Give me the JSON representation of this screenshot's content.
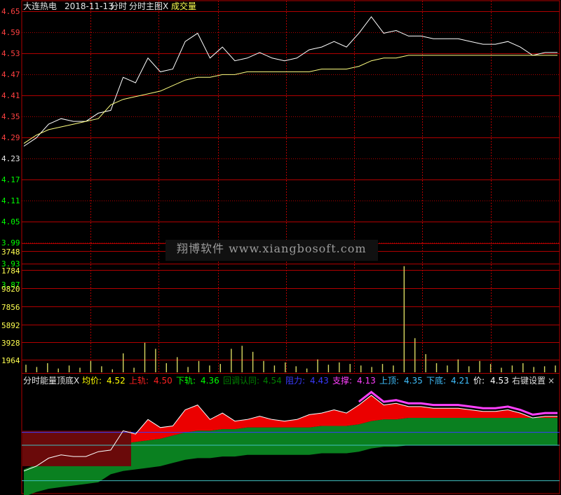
{
  "header": {
    "stock_name": "大连热电",
    "date": "2018-11-13",
    "mode": "分时",
    "main_chart_toggle": "分时主图X",
    "volume_label": "成交量"
  },
  "price_axis": [
    "4.65",
    "4.59",
    "4.53",
    "4.47",
    "4.41",
    "4.35",
    "4.29",
    "4.23",
    "4.17",
    "4.11",
    "4.05",
    "3.99",
    "3.93",
    "3.87"
  ],
  "volume_axis": [
    "3748",
    "1784",
    "9820",
    "7856",
    "5892",
    "3928",
    "1964"
  ],
  "watermark": "翔博软件 www.xiangbosoft.com",
  "indicator": {
    "name": "分时能量顶底X",
    "items": [
      {
        "label": "均价:",
        "value": "4.52",
        "color": "#ffff00"
      },
      {
        "label": "上轨:",
        "value": "4.50",
        "color": "#ff2020"
      },
      {
        "label": "下轨:",
        "value": "4.36",
        "color": "#00ff00"
      },
      {
        "label": "回调认同:",
        "value": "4.54",
        "color": "#008000"
      },
      {
        "label": "阻力:",
        "value": "4.43",
        "color": "#3a3aff"
      },
      {
        "label": "支撑:",
        "value": "4.13",
        "color": "#ff40ff"
      },
      {
        "label": "上顶:",
        "value": "4.35",
        "color": "#40c0ff"
      },
      {
        "label": "下底:",
        "value": "4.21",
        "color": "#40c0ff"
      },
      {
        "label": "价:",
        "value": "4.53",
        "color": "#ffffff"
      }
    ],
    "settings_label": "右键设置",
    "close_label": "×"
  },
  "colors": {
    "grid": "#b00000",
    "price_line": "#ffffff",
    "avg_line": "#ffff80",
    "volume_bar": "#d8d860",
    "up_axis": "#ff4040",
    "down_axis": "#00ff00",
    "volume_axis": "#ffff50"
  },
  "chart_data": [
    {
      "type": "line",
      "series": [
        {
          "values": [
            4.19,
            4.22,
            4.27,
            4.29,
            4.28,
            4.28,
            4.31,
            4.32,
            4.44,
            4.42,
            4.51,
            4.46,
            4.47,
            4.57,
            4.6,
            4.51,
            4.55,
            4.5,
            4.51,
            4.53,
            4.51,
            4.5,
            4.51,
            4.54,
            4.55,
            4.57,
            4.55,
            4.6,
            4.66,
            4.6,
            4.61,
            4.59,
            4.59,
            4.58,
            4.58,
            4.58,
            4.57,
            4.56,
            4.56,
            4.57,
            4.55,
            4.52,
            4.53,
            4.53
          ]
        },
        {
          "values": [
            4.2,
            4.23,
            4.25,
            4.26,
            4.27,
            4.28,
            4.29,
            4.34,
            4.36,
            4.37,
            4.38,
            4.39,
            4.41,
            4.43,
            4.44,
            4.44,
            4.45,
            4.45,
            4.46,
            4.46,
            4.46,
            4.46,
            4.46,
            4.46,
            4.47,
            4.47,
            4.47,
            4.48,
            4.5,
            4.51,
            4.51,
            4.52,
            4.52,
            4.52,
            4.52,
            4.52,
            4.52,
            4.52,
            4.52,
            4.52,
            4.52,
            4.52,
            4.52,
            4.52
          ]
        }
      ],
      "ylim": [
        3.84,
        4.68
      ]
    },
    {
      "type": "bar",
      "values": [
        1000,
        700,
        1200,
        500,
        900,
        600,
        1500,
        800,
        400,
        2500,
        600,
        3900,
        3100,
        1200,
        2000,
        700,
        1500,
        900,
        1100,
        3100,
        3500,
        2700,
        1500,
        900,
        1300,
        800,
        500,
        1700,
        1000,
        1300,
        1100,
        900,
        700,
        1100,
        900,
        14000,
        4500,
        2400,
        1200,
        900,
        1700,
        800,
        1500,
        1100,
        600,
        900,
        1200,
        700,
        800,
        900
      ],
      "ylim": [
        0,
        16000
      ]
    }
  ]
}
